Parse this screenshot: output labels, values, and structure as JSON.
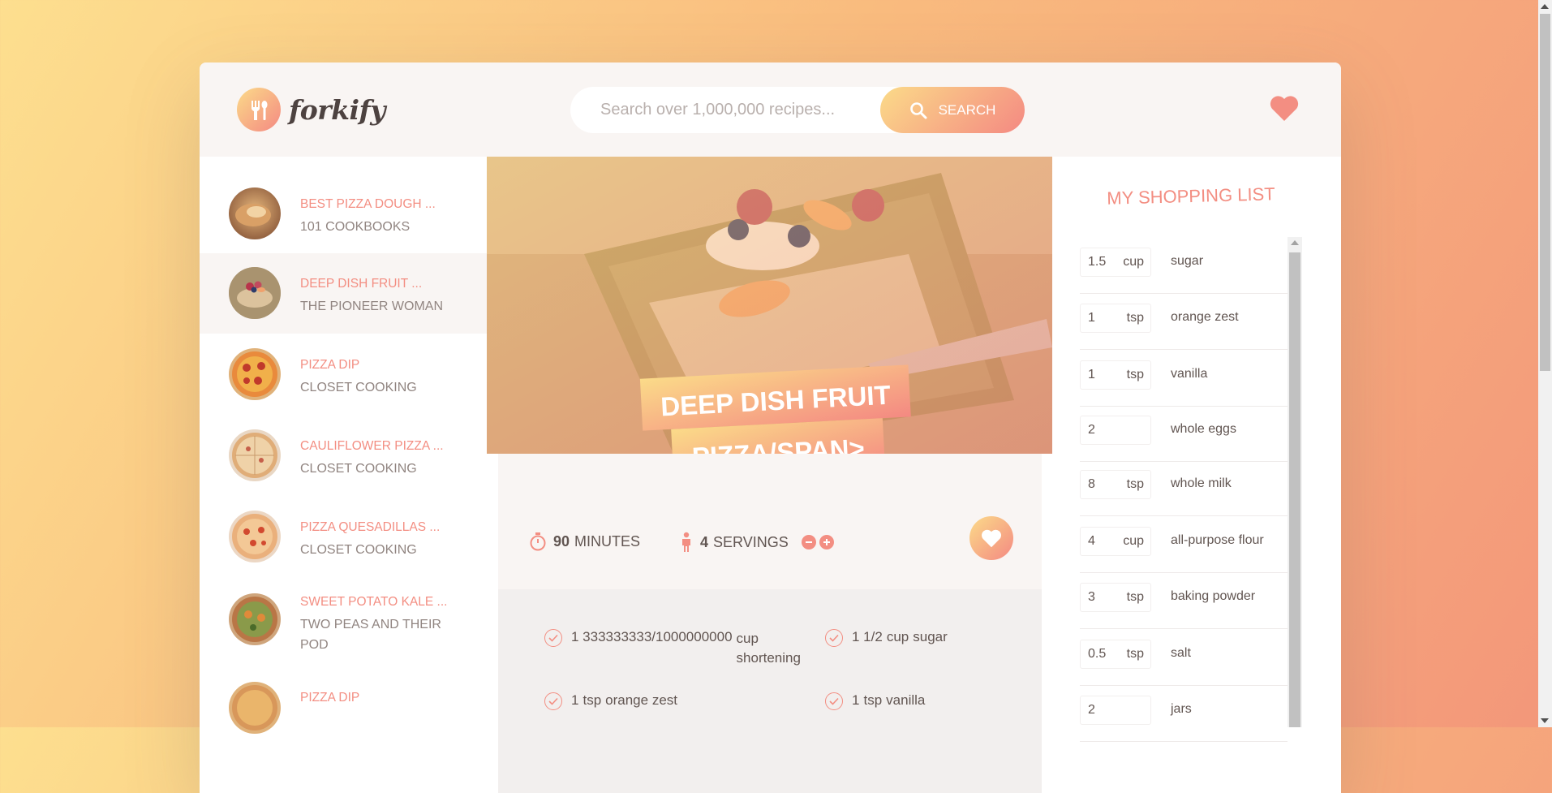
{
  "app": {
    "logo_text": "forkify"
  },
  "search": {
    "placeholder": "Search over 1,000,000 recipes...",
    "button_label": "SEARCH"
  },
  "results": [
    {
      "title": "BEST PIZZA DOUGH ...",
      "publisher": "101 COOKBOOKS",
      "active": false
    },
    {
      "title": "DEEP DISH FRUIT ...",
      "publisher": "THE PIONEER WOMAN",
      "active": true
    },
    {
      "title": "PIZZA DIP",
      "publisher": "CLOSET COOKING",
      "active": false
    },
    {
      "title": "CAULIFLOWER PIZZA ...",
      "publisher": "CLOSET COOKING",
      "active": false
    },
    {
      "title": "PIZZA QUESADILLAS ...",
      "publisher": "CLOSET COOKING",
      "active": false
    },
    {
      "title": "SWEET POTATO KALE ...",
      "publisher": "TWO PEAS AND THEIR POD",
      "active": false
    },
    {
      "title": "PIZZA DIP",
      "publisher": "",
      "active": false
    }
  ],
  "recipe": {
    "title_line1": "DEEP DISH FRUIT",
    "title_line2": "PIZZA/SPAN>",
    "time_value": "90",
    "time_unit": "MINUTES",
    "servings_value": "4",
    "servings_unit": "SERVINGS",
    "ingredients": [
      {
        "count": "1 333333333/1000000000",
        "unit": "cup",
        "desc": "shortening"
      },
      {
        "count": "1 1/2",
        "unit": "cup",
        "desc": "sugar"
      },
      {
        "count": "1",
        "unit": "tsp",
        "desc": "orange zest"
      },
      {
        "count": "1",
        "unit": "tsp",
        "desc": "vanilla"
      }
    ]
  },
  "shopping": {
    "title": "MY SHOPPING LIST",
    "items": [
      {
        "count": "1.5",
        "unit": "cup",
        "desc": "sugar"
      },
      {
        "count": "1",
        "unit": "tsp",
        "desc": "orange zest"
      },
      {
        "count": "1",
        "unit": "tsp",
        "desc": "vanilla"
      },
      {
        "count": "2",
        "unit": "",
        "desc": "whole eggs"
      },
      {
        "count": "8",
        "unit": "tsp",
        "desc": "whole milk"
      },
      {
        "count": "4",
        "unit": "cup",
        "desc": "all-purpose flour"
      },
      {
        "count": "3",
        "unit": "tsp",
        "desc": "baking powder"
      },
      {
        "count": "0.5",
        "unit": "tsp",
        "desc": "salt"
      },
      {
        "count": "2",
        "unit": "",
        "desc": "jars"
      }
    ]
  },
  "colors": {
    "accent": "#f38e82",
    "gradient_start": "#fbdb89",
    "gradient_end": "#f48982",
    "text": "#615551"
  },
  "icons": {
    "logo": "fork-spoon-icon",
    "search": "search-icon",
    "likes": "heart-icon",
    "time": "stopwatch-icon",
    "servings": "person-icon",
    "decrease": "minus-circle-icon",
    "increase": "plus-circle-icon",
    "bookmark": "heart-icon",
    "ingredient": "check-icon"
  }
}
